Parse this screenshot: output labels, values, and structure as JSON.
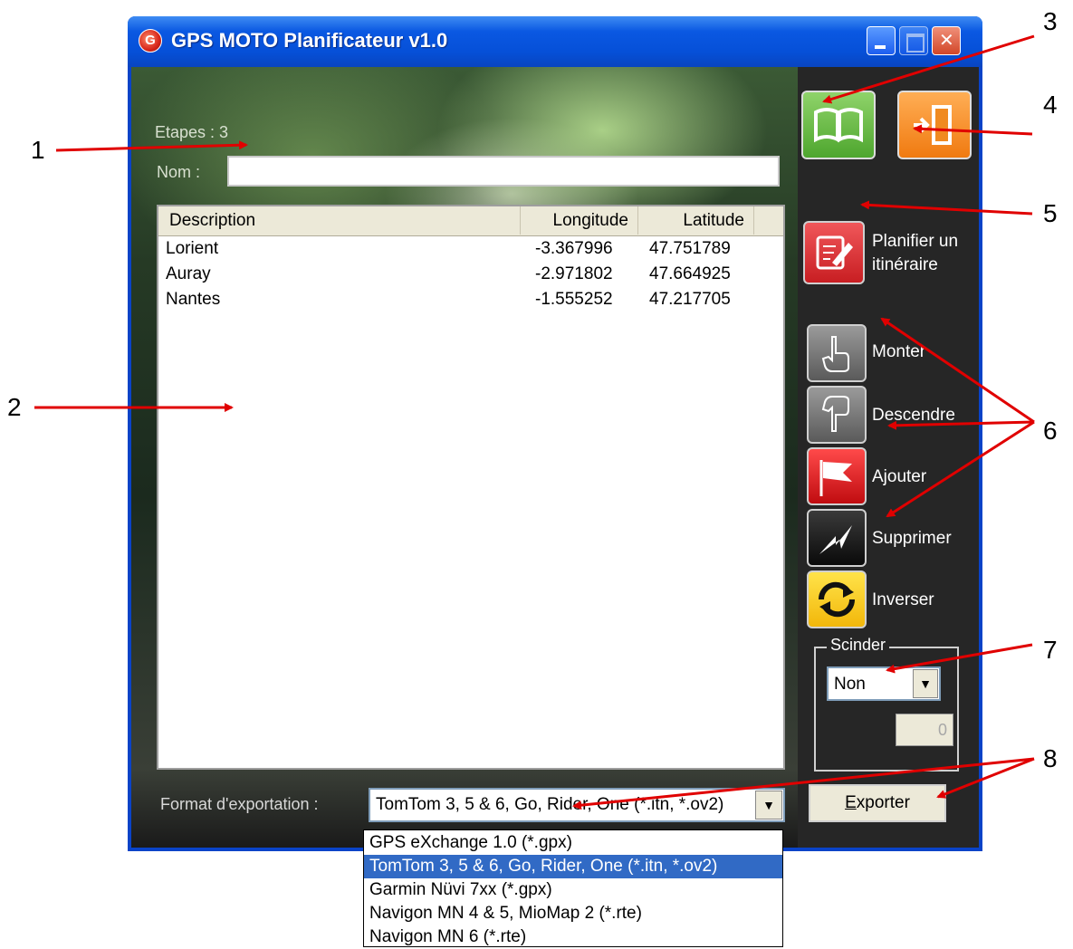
{
  "window": {
    "title": "GPS MOTO Planificateur v1.0"
  },
  "header": {
    "stages_label": "Etapes : 3",
    "name_label": "Nom :",
    "name_value": ""
  },
  "table": {
    "columns": [
      "Description",
      "Longitude",
      "Latitude"
    ],
    "rows": [
      {
        "description": "Lorient",
        "longitude": "-3.367996",
        "latitude": "47.751789"
      },
      {
        "description": "Auray",
        "longitude": "-2.971802",
        "latitude": "47.664925"
      },
      {
        "description": "Nantes",
        "longitude": "-1.555252",
        "latitude": "47.217705"
      }
    ]
  },
  "export": {
    "label": "Format d'exportation :",
    "selected": "TomTom 3, 5 & 6, Go, Rider, One (*.itn, *.ov2)",
    "options": [
      "GPS eXchange 1.0 (*.gpx)",
      "TomTom 3, 5 & 6, Go, Rider, One (*.itn, *.ov2)",
      "Garmin Nüvi 7xx (*.gpx)",
      "Navigon MN 4 & 5, MioMap 2 (*.rte)",
      "Navigon MN 6 (*.rte)"
    ],
    "button_letter": "E",
    "button_rest": "xporter"
  },
  "side": {
    "plan_line1": "Planifier un",
    "plan_line2": "itinéraire",
    "up": "Monter",
    "down": "Descendre",
    "add": "Ajouter",
    "remove": "Supprimer",
    "reverse": "Inverser"
  },
  "split": {
    "caption": "Scinder",
    "value": "Non",
    "number": "0"
  },
  "annotations": [
    "1",
    "2",
    "3",
    "4",
    "5",
    "6",
    "7",
    "8"
  ],
  "icons": {
    "app": "gps-app-icon",
    "guide": "book-icon",
    "quit": "exit-door-icon",
    "plan": "edit-pencil-icon",
    "up": "hand-up-icon",
    "down": "hand-down-icon",
    "add": "flag-icon",
    "remove": "lightning-icon",
    "reverse": "refresh-arrows-icon"
  }
}
